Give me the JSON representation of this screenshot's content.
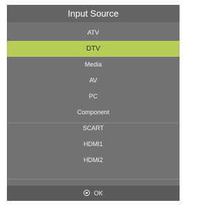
{
  "menu": {
    "title": "Input Source",
    "selected_index": 1,
    "items": [
      {
        "label": "ATV"
      },
      {
        "label": "DTV"
      },
      {
        "label": "Media"
      },
      {
        "label": "AV"
      },
      {
        "label": "PC"
      },
      {
        "label": "Component"
      },
      {
        "label": "SCART"
      },
      {
        "label": "HDMI1"
      },
      {
        "label": "HDMI2"
      }
    ]
  },
  "footer": {
    "icon": "ok-button-icon",
    "label": "OK"
  },
  "colors": {
    "panel": "#727272",
    "title_bar": "#646464",
    "highlight": "#b3cd57",
    "footer_bar": "#5b5b5b",
    "text": "#f2f2f2"
  }
}
